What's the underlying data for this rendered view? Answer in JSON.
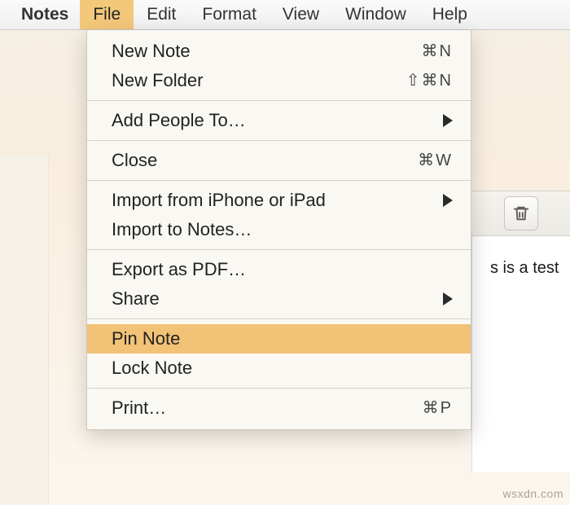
{
  "menubar": {
    "app": "Notes",
    "items": [
      "File",
      "Edit",
      "Format",
      "View",
      "Window",
      "Help"
    ],
    "openIndex": 0
  },
  "fileMenu": {
    "groups": [
      [
        {
          "label": "New Note",
          "shortcut": "⌘N"
        },
        {
          "label": "New Folder",
          "shortcut": "⇧⌘N"
        }
      ],
      [
        {
          "label": "Add People To…",
          "submenu": true
        }
      ],
      [
        {
          "label": "Close",
          "shortcut": "⌘W"
        }
      ],
      [
        {
          "label": "Import from iPhone or iPad",
          "submenu": true
        },
        {
          "label": "Import to Notes…"
        }
      ],
      [
        {
          "label": "Export as PDF…"
        },
        {
          "label": "Share",
          "submenu": true
        }
      ],
      [
        {
          "label": "Pin Note",
          "highlight": true
        },
        {
          "label": "Lock Note"
        }
      ],
      [
        {
          "label": "Print…",
          "shortcut": "⌘P"
        }
      ]
    ]
  },
  "toolbar": {
    "trash_tooltip": "Delete"
  },
  "note": {
    "line1": "s is a test"
  },
  "watermark": "wsxdn.com"
}
